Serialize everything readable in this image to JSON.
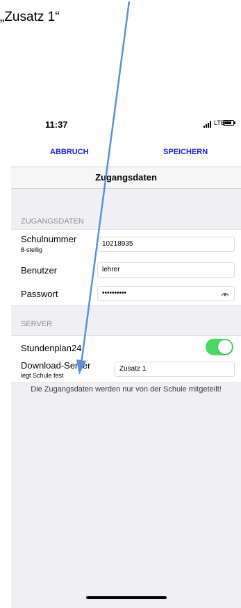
{
  "caption": "„Zusatz 1“",
  "status_bar": {
    "time": "11:37",
    "network": "LTE",
    "battery_level": 0.8
  },
  "nav": {
    "cancel_label": "ABBRUCH",
    "save_label": "SPEICHERN"
  },
  "page_title": "Zugangsdaten",
  "access_section": {
    "header": "ZUGANGSDATEN",
    "school_number_label": "Schulnummer",
    "school_number_hint": "8-stellig",
    "school_number_value": "10218935",
    "user_label": "Benutzer",
    "user_value": "lehrer",
    "password_label": "Passwort",
    "password_value": "••••••••••"
  },
  "server_section": {
    "header": "SERVER",
    "stundenplan_label": "Stundenplan24",
    "stundenplan_enabled": true,
    "download_server_label": "Download-Server",
    "download_server_hint": "legt Schule fest",
    "download_server_value": "Zusatz 1"
  },
  "footer_note": "Die Zugangsdaten werden nur von der Schule mitgeteilt!",
  "icons": {
    "eye": "eye-icon",
    "signal": "signal-bars-icon",
    "battery": "battery-icon"
  },
  "colors": {
    "accent": "#1a1adb",
    "toggle_on": "#4cd964",
    "arrow": "#5b8fd9"
  }
}
